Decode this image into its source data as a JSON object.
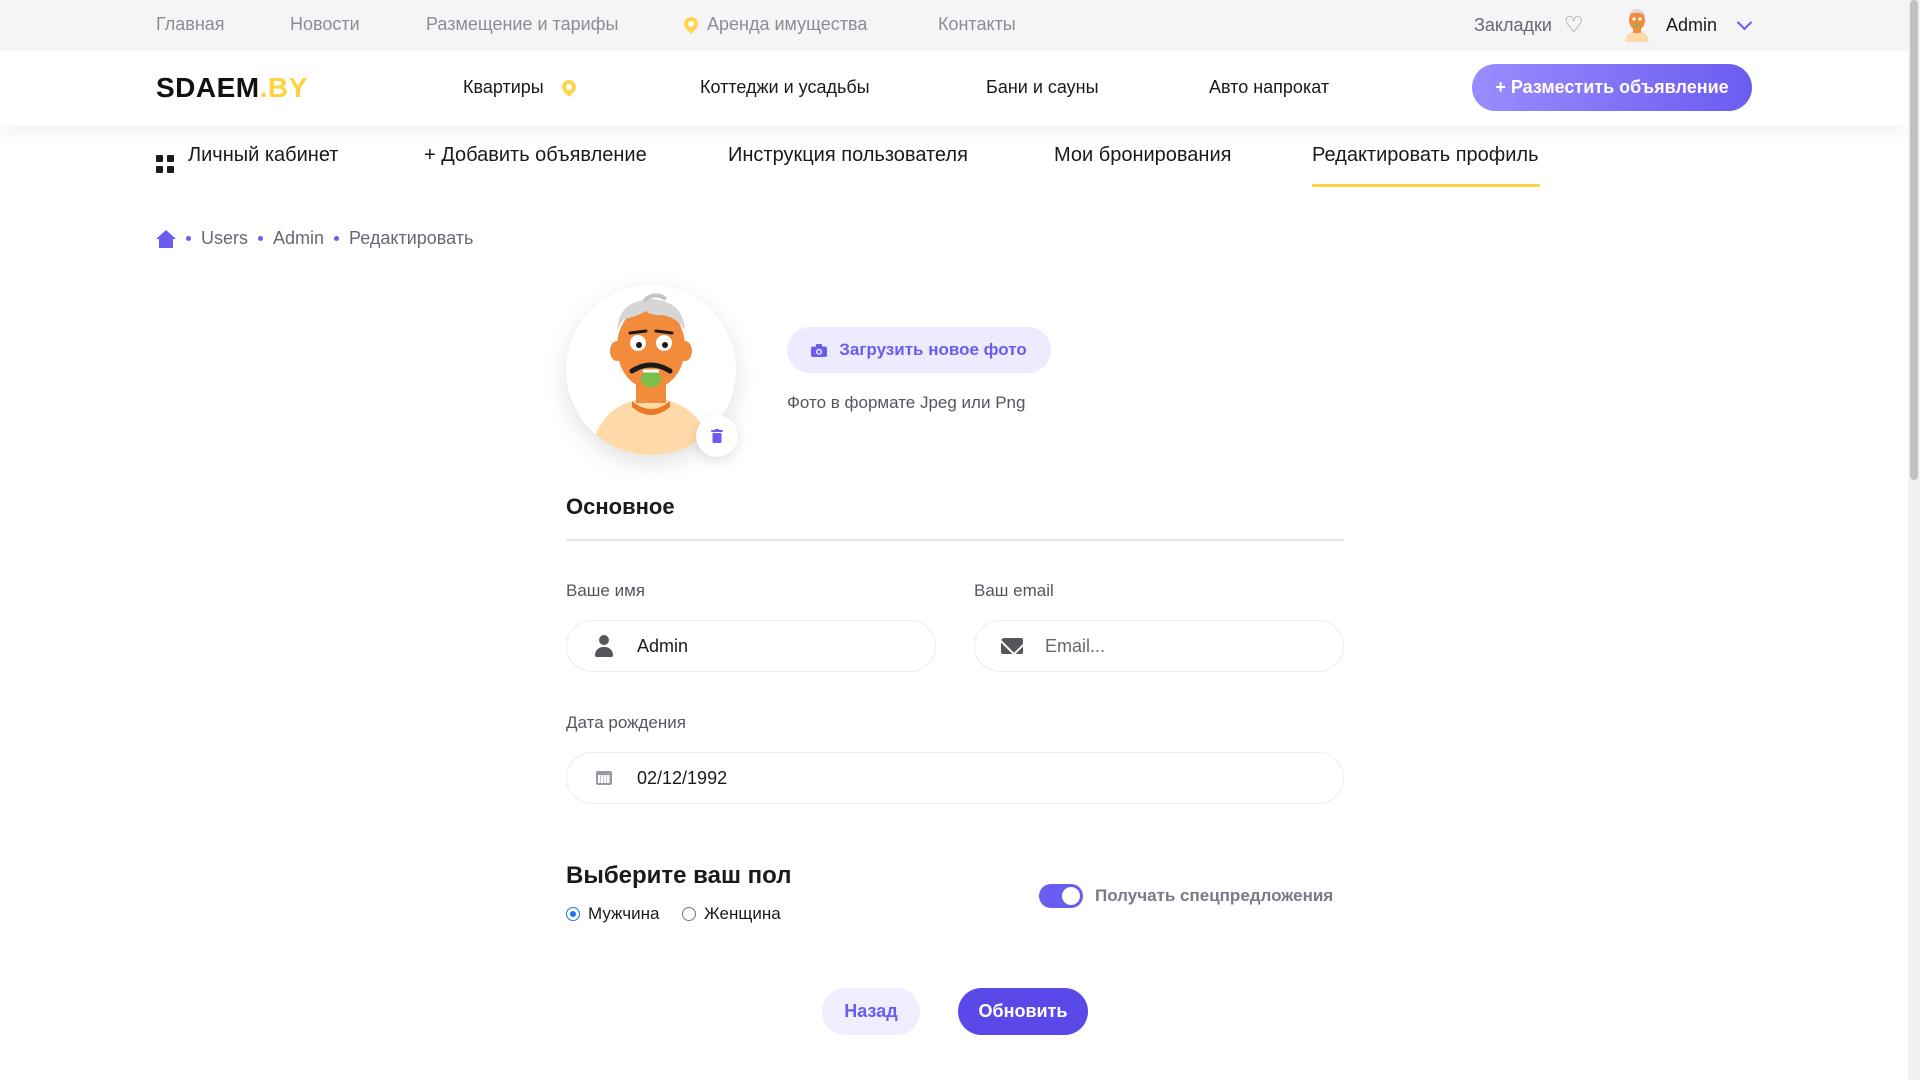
{
  "topbar": {
    "links": [
      "Главная",
      "Новости",
      "Размещение и тарифы",
      "Аренда имущества",
      "Контакты"
    ],
    "bookmarks_label": "Закладки",
    "user_name": "Admin"
  },
  "header": {
    "logo_main": "SDAEM",
    "logo_accent": ".BY",
    "nav": [
      "Квартиры",
      "Коттеджи и усадьбы",
      "Бани и сауны",
      "Авто напрокат"
    ],
    "cta_label": "+ Разместить объявление"
  },
  "tabs": [
    "Личный кабинет",
    "+ Добавить объявление",
    "Инструкция пользователя",
    "Мои бронирования",
    "Редактировать профиль"
  ],
  "active_tab": "Редактировать профиль",
  "breadcrumb": [
    "Users",
    "Admin",
    "Редактировать"
  ],
  "photo": {
    "upload_label": "Загрузить новое фото",
    "hint": "Фото в формате Jpeg или Png"
  },
  "form": {
    "section_title": "Основное",
    "name_label": "Ваше имя",
    "name_value": "Admin",
    "email_label": "Ваш email",
    "email_placeholder": "Email...",
    "birth_label": "Дата рождения",
    "birth_value": "02/12/1992",
    "gender_title": "Выберите ваш пол",
    "gender_options": [
      "Мужчина",
      "Женщина"
    ],
    "gender_selected": "Мужчина",
    "offers_label": "Получать спецпредложения",
    "offers_enabled": true
  },
  "actions": {
    "back_label": "Назад",
    "update_label": "Обновить"
  },
  "colors": {
    "accent": "#6b5cf0",
    "yellow": "#ffd23f"
  }
}
